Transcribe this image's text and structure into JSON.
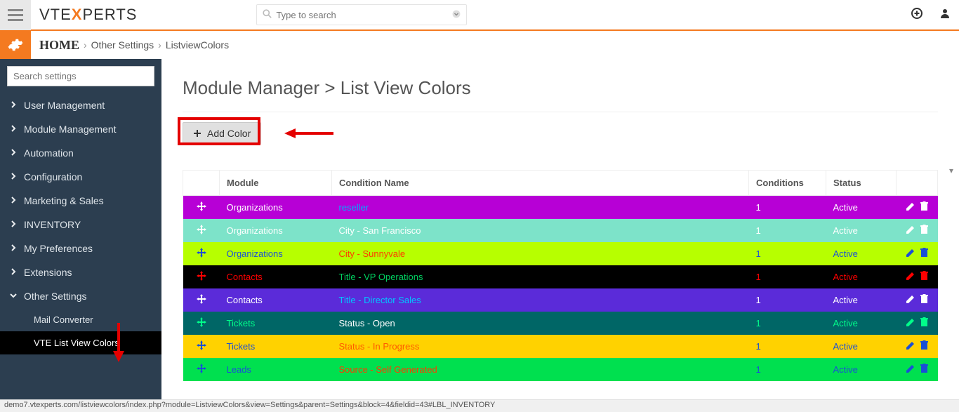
{
  "top": {
    "logo_left": "VTE",
    "logo_mid": "X",
    "logo_right": "PERTS",
    "search_placeholder": "Type to search"
  },
  "breadcrumb": {
    "home": "HOME",
    "path1": "Other Settings",
    "path2": "ListviewColors"
  },
  "sidebar": {
    "search_placeholder": "Search settings",
    "items": [
      {
        "label": "User Management",
        "expanded": false
      },
      {
        "label": "Module Management",
        "expanded": false
      },
      {
        "label": "Automation",
        "expanded": false
      },
      {
        "label": "Configuration",
        "expanded": false
      },
      {
        "label": "Marketing & Sales",
        "expanded": false
      },
      {
        "label": "INVENTORY",
        "expanded": false
      },
      {
        "label": "My Preferences",
        "expanded": false
      },
      {
        "label": "Extensions",
        "expanded": false
      },
      {
        "label": "Other Settings",
        "expanded": true
      }
    ],
    "sub_items": [
      {
        "label": "Mail Converter",
        "active": false
      },
      {
        "label": "VTE List View Colors",
        "active": true
      }
    ]
  },
  "page": {
    "title": "Module Manager > List View Colors",
    "add_label": "Add Color"
  },
  "table": {
    "headers": {
      "module": "Module",
      "condition": "Condition Name",
      "conditions": "Conditions",
      "status": "Status"
    },
    "rows": [
      {
        "bg": "#b700d6",
        "handle": "#ffffff",
        "module": "Organizations",
        "module_color": "#ffffff",
        "condition": "reseller",
        "cond_color": "#00aaff",
        "conds": "1",
        "conds_color": "#ffffff",
        "status": "Active",
        "status_color": "#ffffff",
        "edit": "#ffffff",
        "trash": "#ffffff"
      },
      {
        "bg": "#7de3c9",
        "handle": "#ffffff",
        "module": "Organizations",
        "module_color": "#ffffff",
        "condition": "City - San Francisco",
        "cond_color": "#ffffff",
        "conds": "1",
        "conds_color": "#ffffff",
        "status": "Active",
        "status_color": "#ffffff",
        "edit": "#ffffff",
        "trash": "#ffffff"
      },
      {
        "bg": "#b7ff00",
        "handle": "#1a4fd6",
        "module": "Organizations",
        "module_color": "#1a4fd6",
        "condition": "City - Sunnyvale",
        "cond_color": "#ff3a00",
        "conds": "1",
        "conds_color": "#1a4fd6",
        "status": "Active",
        "status_color": "#1a4fd6",
        "edit": "#1a4fd6",
        "trash": "#1a4fd6"
      },
      {
        "bg": "#000000",
        "handle": "#ff0000",
        "module": "Contacts",
        "module_color": "#ff0000",
        "condition": "Title - VP Operations",
        "cond_color": "#00d060",
        "conds": "1",
        "conds_color": "#ff0000",
        "status": "Active",
        "status_color": "#ff0000",
        "edit": "#ff0000",
        "trash": "#ff0000"
      },
      {
        "bg": "#5b2bd9",
        "handle": "#ffffff",
        "module": "Contacts",
        "module_color": "#ffffff",
        "condition": "Title - Director Sales",
        "cond_color": "#00c6ff",
        "conds": "1",
        "conds_color": "#ffffff",
        "status": "Active",
        "status_color": "#ffffff",
        "edit": "#ffffff",
        "trash": "#ffffff"
      },
      {
        "bg": "#006666",
        "handle": "#00ff8a",
        "module": "Tickets",
        "module_color": "#00ff8a",
        "condition": "Status - Open",
        "cond_color": "#ffffff",
        "conds": "1",
        "conds_color": "#00ff8a",
        "status": "Active",
        "status_color": "#00ff8a",
        "edit": "#00ff8a",
        "trash": "#00ff8a"
      },
      {
        "bg": "#ffd200",
        "handle": "#1a4fd6",
        "module": "Tickets",
        "module_color": "#1a4fd6",
        "condition": "Status - In Progress",
        "cond_color": "#ff5a00",
        "conds": "1",
        "conds_color": "#1a4fd6",
        "status": "Active",
        "status_color": "#1a4fd6",
        "edit": "#1a4fd6",
        "trash": "#1a4fd6"
      },
      {
        "bg": "#00e04f",
        "handle": "#1a4fd6",
        "module": "Leads",
        "module_color": "#1a4fd6",
        "condition": "Source - Self Generated",
        "cond_color": "#ff3a00",
        "conds": "1",
        "conds_color": "#1a4fd6",
        "status": "Active",
        "status_color": "#1a4fd6",
        "edit": "#1a4fd6",
        "trash": "#1a4fd6"
      }
    ]
  },
  "statusbar": "demo7.vtexperts.com/listviewcolors/index.php?module=ListviewColors&view=Settings&parent=Settings&block=4&fieldid=43#LBL_INVENTORY"
}
